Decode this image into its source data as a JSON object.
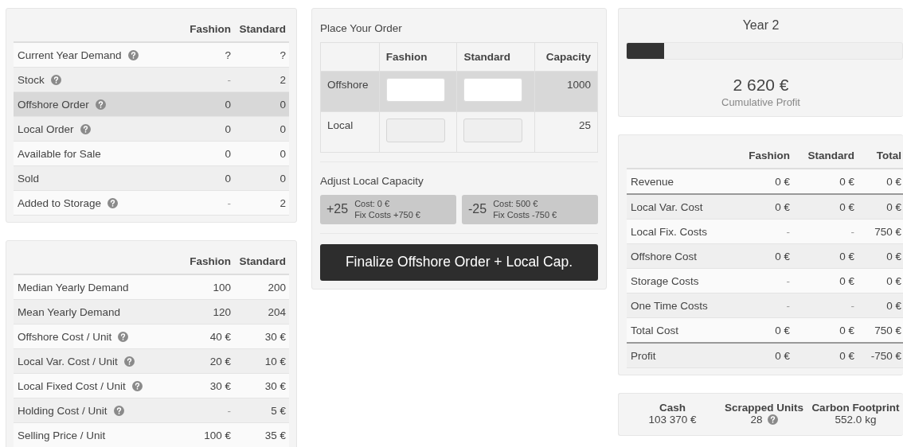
{
  "status_table": {
    "columns": [
      "Fashion",
      "Standard"
    ],
    "rows": [
      {
        "label": "Current Year Demand",
        "help": true,
        "highlighted": false,
        "values": [
          "?",
          "?"
        ]
      },
      {
        "label": "Stock",
        "help": true,
        "highlighted": false,
        "values": [
          "-",
          "2"
        ]
      },
      {
        "label": "Offshore Order",
        "help": true,
        "highlighted": true,
        "values": [
          "0",
          "0"
        ]
      },
      {
        "label": "Local Order",
        "help": true,
        "highlighted": false,
        "values": [
          "0",
          "0"
        ]
      },
      {
        "label": "Available for Sale",
        "help": false,
        "highlighted": false,
        "values": [
          "0",
          "0"
        ]
      },
      {
        "label": "Sold",
        "help": false,
        "highlighted": false,
        "values": [
          "0",
          "0"
        ]
      },
      {
        "label": "Added to Storage",
        "help": true,
        "highlighted": false,
        "values": [
          "-",
          "2"
        ]
      }
    ]
  },
  "parameters_table": {
    "columns": [
      "Fashion",
      "Standard"
    ],
    "rows": [
      {
        "label": "Median Yearly Demand",
        "help": false,
        "values": [
          "100",
          "200"
        ]
      },
      {
        "label": "Mean Yearly Demand",
        "help": false,
        "values": [
          "120",
          "204"
        ]
      },
      {
        "label": "Offshore Cost / Unit",
        "help": true,
        "values": [
          "40 €",
          "30 €"
        ]
      },
      {
        "label": "Local Var. Cost / Unit",
        "help": true,
        "values": [
          "20 €",
          "10 €"
        ]
      },
      {
        "label": "Local Fixed Cost / Unit",
        "help": true,
        "values": [
          "30 €",
          "30 €"
        ]
      },
      {
        "label": "Holding Cost / Unit",
        "help": true,
        "values": [
          "-",
          "5 €"
        ]
      },
      {
        "label": "Selling Price / Unit",
        "help": false,
        "values": [
          "100 €",
          "35 €"
        ]
      }
    ]
  },
  "order": {
    "title": "Place Your Order",
    "columns": [
      "Fashion",
      "Standard",
      "Capacity"
    ],
    "rows": [
      {
        "label": "Offshore",
        "highlighted": true,
        "disabled": false,
        "capacity": "1000"
      },
      {
        "label": "Local",
        "highlighted": false,
        "disabled": true,
        "capacity": "25"
      }
    ],
    "adjust_title": "Adjust Local Capacity",
    "adjust_buttons": [
      {
        "amount": "+25",
        "cost": "Cost: 0 €",
        "fix": "Fix Costs +750 €"
      },
      {
        "amount": "-25",
        "cost": "Cost: 500 €",
        "fix": "Fix Costs -750 €"
      }
    ],
    "finalize_button": "Finalize Offshore Order + Local Cap."
  },
  "progress": {
    "title": "Year 2",
    "level": 0.135,
    "amount": "2 620 €",
    "caption": "Cumulative Profit"
  },
  "finance_table": {
    "columns": [
      "Fashion",
      "Standard",
      "Total"
    ],
    "rows": [
      {
        "label": "Revenue",
        "divider_after": true,
        "values": [
          "0 €",
          "0 €",
          "0 €"
        ]
      },
      {
        "label": "Local Var. Cost",
        "divider_after": false,
        "values": [
          "0 €",
          "0 €",
          "0 €"
        ]
      },
      {
        "label": "Local Fix. Costs",
        "divider_after": false,
        "values": [
          "-",
          "-",
          "750 €"
        ]
      },
      {
        "label": "Offshore Cost",
        "divider_after": false,
        "values": [
          "0 €",
          "0 €",
          "0 €"
        ]
      },
      {
        "label": "Storage Costs",
        "divider_after": false,
        "values": [
          "-",
          "0 €",
          "0 €"
        ]
      },
      {
        "label": "One Time Costs",
        "divider_after": false,
        "values": [
          "-",
          "-",
          "0 €"
        ]
      },
      {
        "label": "Total Cost",
        "divider_after": true,
        "values": [
          "0 €",
          "0 €",
          "750 €"
        ]
      },
      {
        "label": "Profit",
        "divider_after": false,
        "values": [
          "0 €",
          "0 €",
          "-750 €"
        ]
      }
    ]
  },
  "stats": [
    {
      "label": "Cash",
      "value": "103 370 €",
      "help": false
    },
    {
      "label": "Scrapped Units",
      "value": "28",
      "help": true
    },
    {
      "label": "Carbon Footprint",
      "value": "552.0 kg",
      "help": false
    }
  ]
}
